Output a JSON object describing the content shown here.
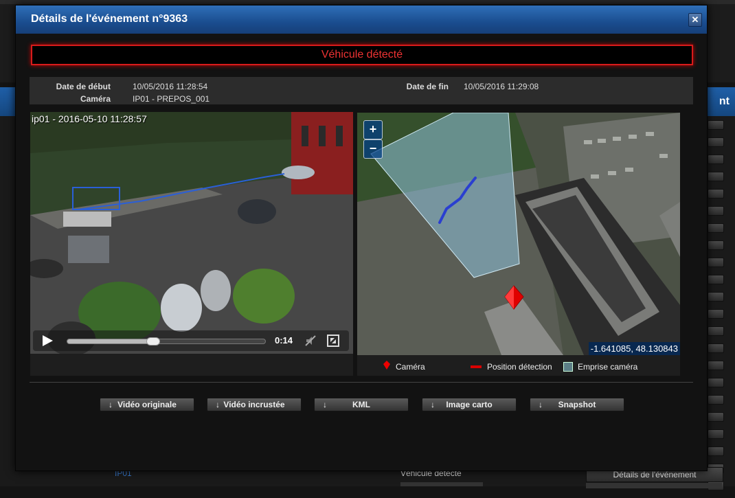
{
  "background": {
    "header_right": "nt",
    "row": {
      "camera": "IP01",
      "event": "Véhicule détecté",
      "button": "Détails de l'événement"
    }
  },
  "modal": {
    "title": "Détails de l'événement n°9363",
    "close_icon": "close-icon",
    "alert": "Véhicule détecté",
    "info": {
      "start_label": "Date de début",
      "start_value": "10/05/2016 11:28:54",
      "end_label": "Date de fin",
      "end_value": "10/05/2016 11:29:08",
      "camera_label": "Caméra",
      "camera_value": "IP01 - PREPOS_001"
    },
    "video": {
      "timestamp": "ip01 - 2016-05-10 11:28:57",
      "time": "0:14",
      "progress": 0.43
    },
    "map": {
      "zoom_in": "+",
      "zoom_out": "−",
      "coords": "-1.641085, 48.130843"
    },
    "legend": {
      "camera": "Caméra",
      "detection": "Position détection",
      "coverage": "Emprise caméra"
    },
    "buttons": [
      {
        "label": "Vidéo originale"
      },
      {
        "label": "Vidéo incrustée"
      },
      {
        "label": "KML"
      },
      {
        "label": "Image carto"
      },
      {
        "label": "Snapshot"
      }
    ],
    "colors": {
      "alert": "#e33333",
      "header": "#1a4d8f",
      "detection": "#2a4fd0",
      "coverage": "#8fc2dc"
    }
  }
}
